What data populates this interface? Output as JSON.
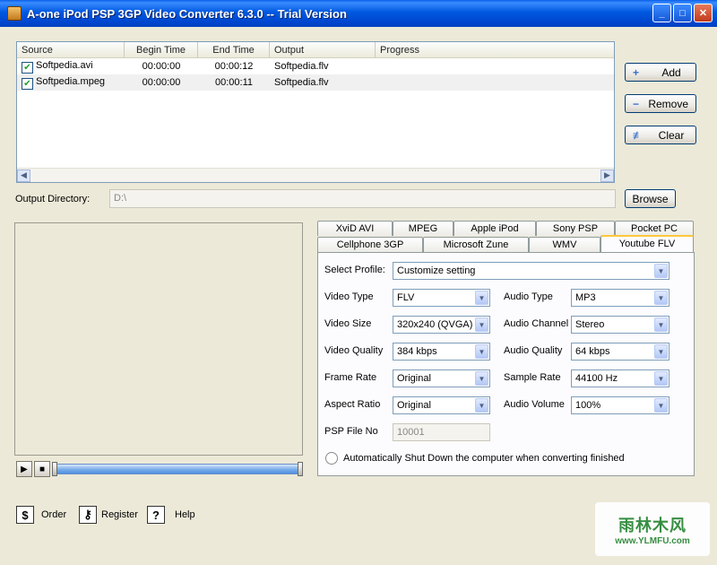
{
  "window": {
    "title": "A-one iPod PSP 3GP Video Converter 6.3.0 -- Trial Version",
    "minimize": "_",
    "maximize": "□",
    "close": "✕"
  },
  "filelist": {
    "columns": [
      "Source",
      "Begin Time",
      "End Time",
      "Output",
      "Progress"
    ],
    "rows": [
      {
        "source": "Softpedia.avi",
        "begin": "00:00:00",
        "end": "00:00:12",
        "output": "Softpedia.flv",
        "progress": ""
      },
      {
        "source": "Softpedia.mpeg",
        "begin": "00:00:00",
        "end": "00:00:11",
        "output": "Softpedia.flv",
        "progress": ""
      }
    ]
  },
  "side_buttons": {
    "add": "Add",
    "remove": "Remove",
    "clear": "Clear"
  },
  "output_dir": {
    "label": "Output Directory:",
    "value": "D:\\",
    "browse": "Browse"
  },
  "tabs": {
    "row1": [
      "XviD AVI",
      "MPEG",
      "Apple iPod",
      "Sony PSP",
      "Pocket PC"
    ],
    "row2": [
      "Cellphone 3GP",
      "Microsoft Zune",
      "WMV",
      "Youtube FLV"
    ],
    "active": "Youtube FLV"
  },
  "settings": {
    "select_profile_label": "Select Profile:",
    "select_profile_value": "Customize setting",
    "video_type_label": "Video Type",
    "video_type_value": "FLV",
    "audio_type_label": "Audio Type",
    "audio_type_value": "MP3",
    "video_size_label": "Video Size",
    "video_size_value": "320x240 (QVGA)",
    "audio_channel_label": "Audio Channel",
    "audio_channel_value": "Stereo",
    "video_quality_label": "Video Quality",
    "video_quality_value": "384 kbps",
    "audio_quality_label": "Audio Quality",
    "audio_quality_value": "64 kbps",
    "frame_rate_label": "Frame Rate",
    "frame_rate_value": "Original",
    "sample_rate_label": "Sample Rate",
    "sample_rate_value": "44100 Hz",
    "aspect_ratio_label": "Aspect Ratio",
    "aspect_ratio_value": "Original",
    "audio_volume_label": "Audio Volume",
    "audio_volume_value": "100%",
    "psp_file_no_label": "PSP File No",
    "psp_file_no_value": "10001",
    "shutdown_label": "Automatically Shut Down the computer when converting finished"
  },
  "bottom": {
    "order": "Order",
    "register": "Register",
    "help": "Help"
  },
  "watermark": {
    "text": "雨林木风",
    "url": "www.YLMFU.com"
  }
}
